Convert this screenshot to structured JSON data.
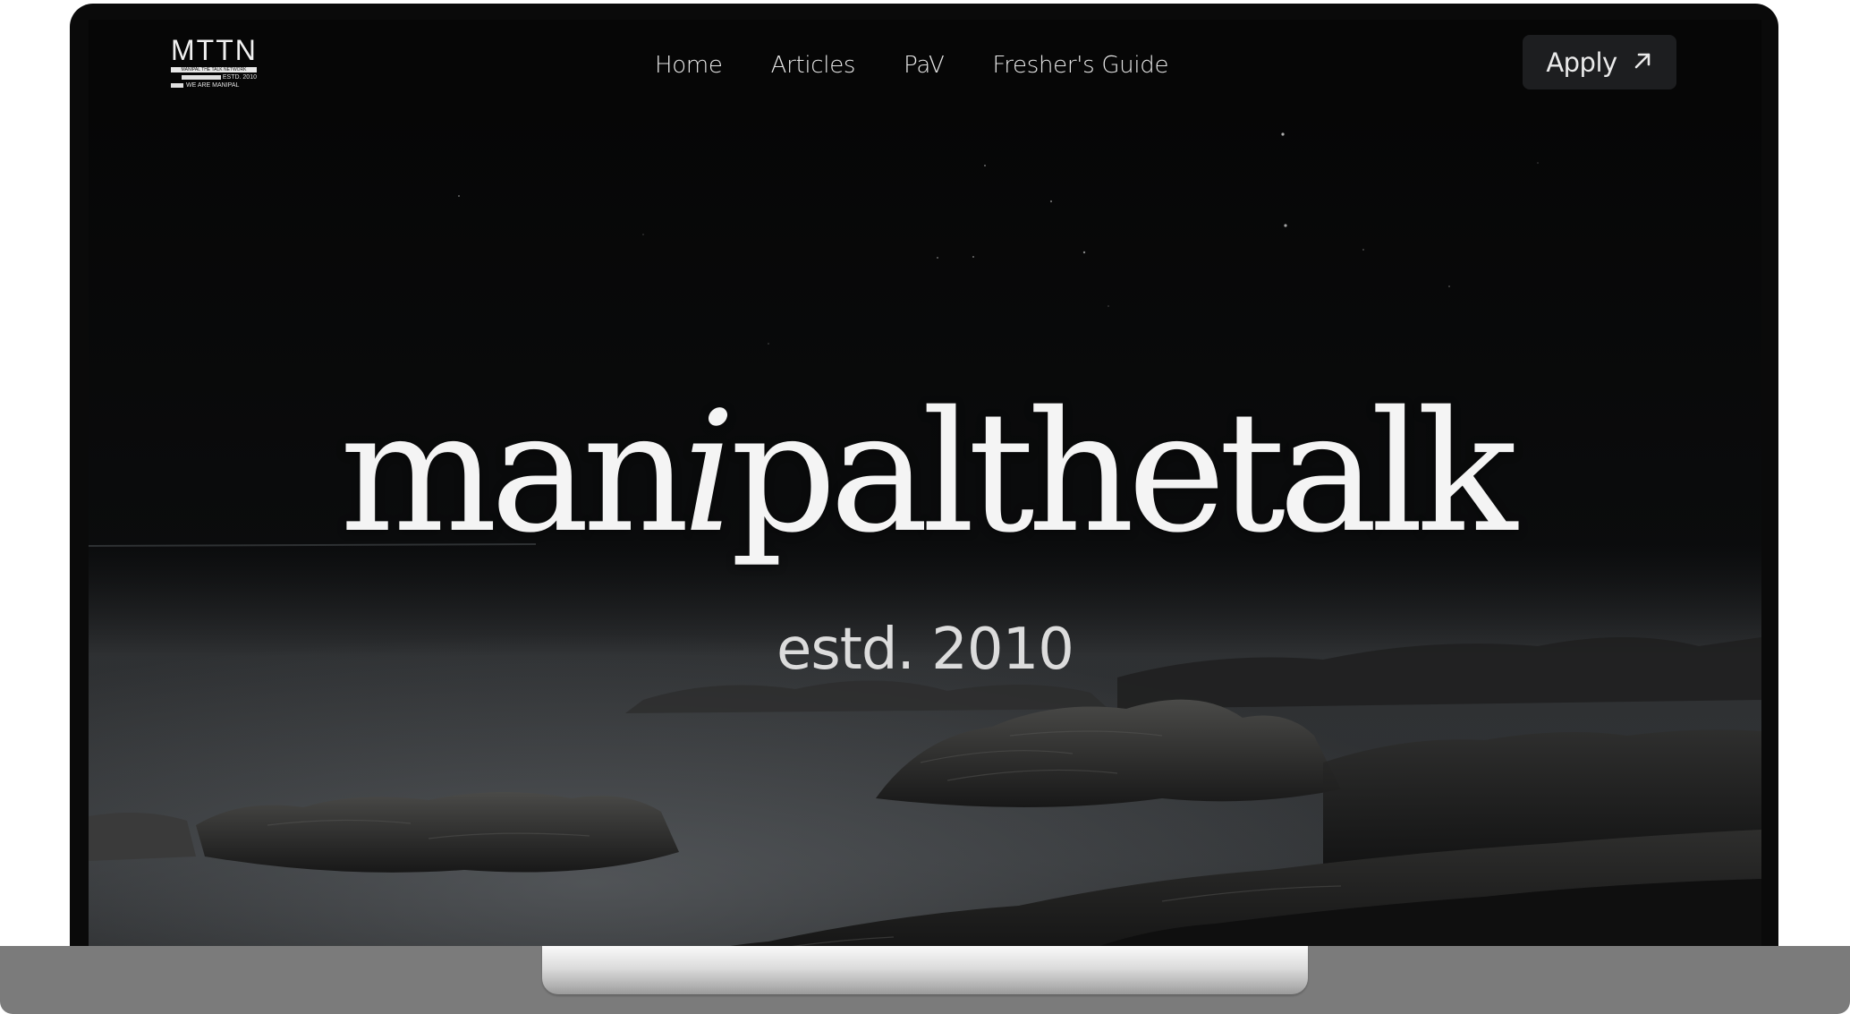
{
  "logo": {
    "title": "MTTN",
    "tagline": "MANIPAL THE TALK NETWORK",
    "estd": "ESTD. 2010",
    "motto": "WE ARE MANIPAL"
  },
  "nav": {
    "items": [
      {
        "label": "Home"
      },
      {
        "label": "Articles"
      },
      {
        "label": "PaV"
      },
      {
        "label": "Fresher's Guide"
      }
    ],
    "apply_label": "Apply"
  },
  "hero": {
    "title_part1": "man",
    "title_italic": "i",
    "title_part2": "palthetalk",
    "subtitle": "estd. 2010"
  },
  "theme": {
    "background": "#060606",
    "text": "#f4f4f4",
    "button_bg": "#1d1e20"
  },
  "icons": {
    "apply": "arrow-up-right-icon"
  }
}
